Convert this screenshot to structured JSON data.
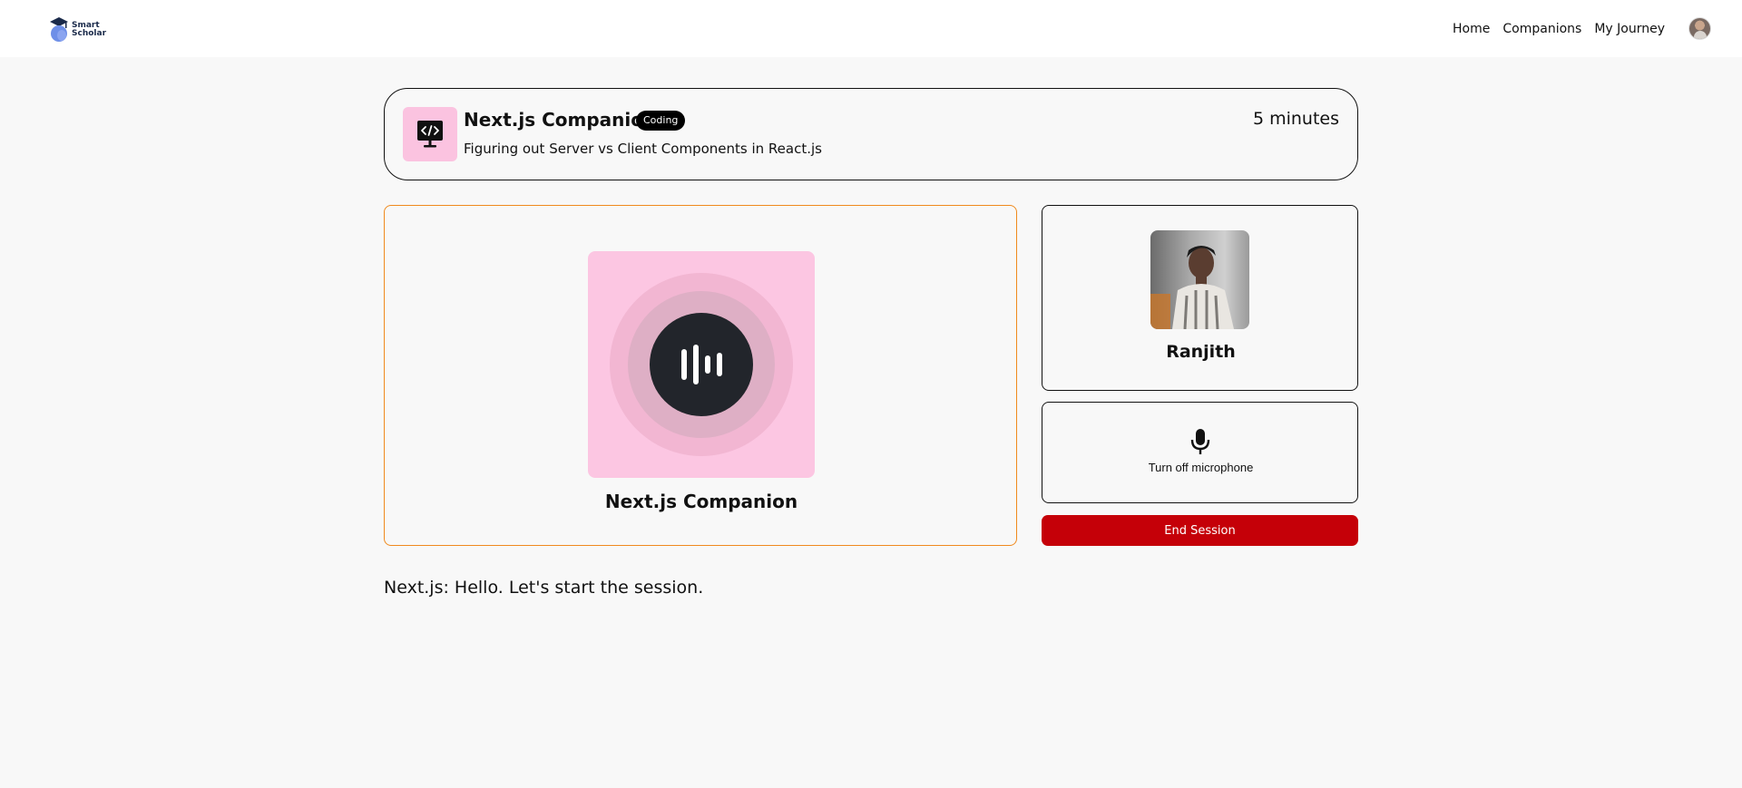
{
  "navbar": {
    "logo_line1": "Smart",
    "logo_line2": "Scholar",
    "links": [
      "Home",
      "Companions",
      "My Journey"
    ],
    "avatar_icon": "user-avatar"
  },
  "companion": {
    "title": "Next.js Companion",
    "subject": "Coding",
    "topic": "Figuring out Server vs Client Components in React.js",
    "duration": "5 minutes",
    "subject_icon": "code-monitor-icon",
    "accent_color": "#fbc3e0",
    "border_color": "#f08a1e"
  },
  "session": {
    "companion_name": "Next.js Companion",
    "speaking_icon": "sound-wave-icon",
    "user_name": "Ranjith",
    "mic_label": "Turn off microphone",
    "mic_icon": "microphone-icon",
    "end_label": "End Session",
    "end_color": "#c50008"
  },
  "transcript": [
    "Next.js: Hello. Let's start the session."
  ]
}
